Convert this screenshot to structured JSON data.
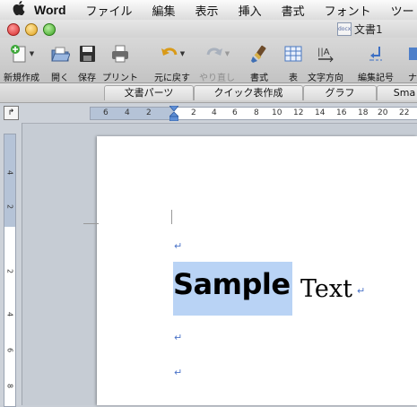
{
  "menubar": {
    "apple": "",
    "items": [
      "Word",
      "ファイル",
      "編集",
      "表示",
      "挿入",
      "書式",
      "フォント",
      "ツー"
    ]
  },
  "window": {
    "title": "文書1",
    "doc_icon": "docx"
  },
  "toolbar": {
    "buttons": [
      {
        "label": "新規作成",
        "icon": "new-document-icon",
        "dim": false
      },
      {
        "label": "開く",
        "icon": "open-folder-icon",
        "dim": false
      },
      {
        "label": "保存",
        "icon": "save-disk-icon",
        "dim": false
      },
      {
        "label": "プリント",
        "icon": "printer-icon",
        "dim": false
      },
      {
        "label": "元に戻す",
        "icon": "undo-icon",
        "dim": false
      },
      {
        "label": "やり直し",
        "icon": "redo-icon",
        "dim": true
      },
      {
        "label": "書式",
        "icon": "format-brush-icon",
        "dim": false
      },
      {
        "label": "表",
        "icon": "table-icon",
        "dim": false
      },
      {
        "label": "文字方向",
        "icon": "text-direction-icon",
        "dim": false
      },
      {
        "label": "編集記号",
        "icon": "formatting-marks-icon",
        "dim": false
      }
    ]
  },
  "gallery": {
    "tabs": [
      "文書パーツ",
      "クイック表作成",
      "グラフ",
      "Sma"
    ]
  },
  "ruler": {
    "tab_selector": "↱",
    "h_numbers": [
      "6",
      "4",
      "2",
      "2",
      "4",
      "6",
      "8",
      "10",
      "12",
      "14",
      "16",
      "18",
      "20",
      "22"
    ],
    "v_numbers": [
      "4",
      "2",
      "2",
      "4",
      "6",
      "8"
    ]
  },
  "document": {
    "pilcrow": "↵",
    "sample": "Sample",
    "text": "Text"
  },
  "colors": {
    "selection": "#b9d3f5",
    "paragraph_mark": "#4c74c8",
    "ruler_margin": "#b5c3d7"
  }
}
